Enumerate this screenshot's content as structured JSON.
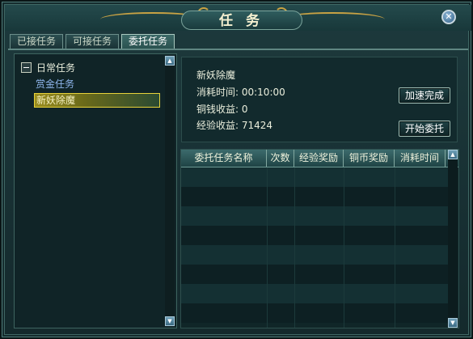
{
  "window": {
    "title": "任务",
    "close_icon": "close-icon"
  },
  "tabs": [
    {
      "label": "已接任务",
      "active": false
    },
    {
      "label": "可接任务",
      "active": false
    },
    {
      "label": "委托任务",
      "active": true
    }
  ],
  "task_tree": {
    "category": "日常任务",
    "items": [
      {
        "label": "赏金任务",
        "selected": false
      },
      {
        "label": "新妖除魔",
        "selected": true
      }
    ]
  },
  "detail": {
    "name": "新妖除魔",
    "time_cost": "消耗时间: 00:10:00",
    "copper_income": "铜钱收益: 0",
    "exp_income": "经验收益: 71424",
    "speed_up_label": "加速完成",
    "start_label": "开始委托"
  },
  "delegate_table": {
    "columns": [
      "委托任务名称",
      "次数",
      "经验奖励",
      "铜币奖励",
      "消耗时间"
    ],
    "rows": []
  },
  "colors": {
    "accent_gold": "#c8a244",
    "selection_border": "#e7d23a",
    "link_blue": "#8fb6ec"
  }
}
